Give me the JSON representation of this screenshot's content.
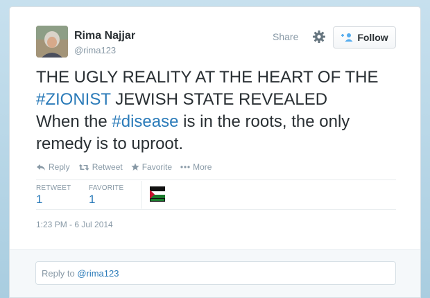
{
  "author": {
    "name": "Rima Najjar",
    "handle": "@rima123"
  },
  "header": {
    "share_label": "Share",
    "follow_label": "Follow"
  },
  "tweet": {
    "line1": "THE UGLY REALITY AT THE HEART OF THE",
    "hashtag1": "#ZIONIST",
    "line2_rest": " JEWISH STATE REVEALED",
    "line3_pre": " When the ",
    "hashtag2": "#disease",
    "line3_post": " is in the roots, the only remedy is to uproot."
  },
  "actions": {
    "reply": "Reply",
    "retweet": "Retweet",
    "favorite": "Favorite",
    "more": "More"
  },
  "stats": {
    "retweet_label": "RETWEET",
    "retweet_count": "1",
    "favorite_label": "FAVORITE",
    "favorite_count": "1"
  },
  "timestamp": "1:23 PM - 6 Jul 2014",
  "reply_box": {
    "prefix": "Reply to ",
    "mention": "@rima123"
  },
  "colors": {
    "link": "#2b7bb9",
    "muted": "#8899a6",
    "text": "#292f33"
  }
}
